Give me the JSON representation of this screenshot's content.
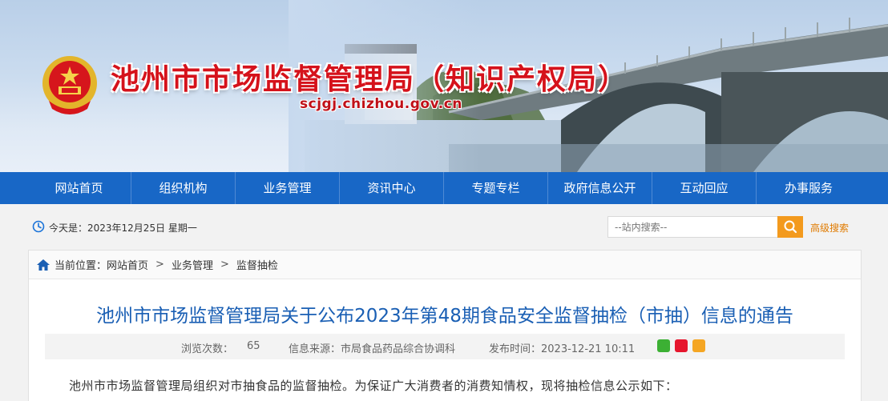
{
  "header": {
    "site_title": "池州市市场监督管理局（知识产权局）",
    "site_domain": "scjgj.chizhou.gov.cn",
    "emblem_icon": "national-emblem-icon"
  },
  "nav": {
    "items": [
      "网站首页",
      "组织机构",
      "业务管理",
      "资讯中心",
      "专题专栏",
      "政府信息公开",
      "互动回应",
      "办事服务"
    ]
  },
  "info_bar": {
    "date_text": "今天是：2023年12月25日 星期一",
    "search_placeholder": "--站内搜索--",
    "advanced_search": "高级搜索"
  },
  "breadcrumb": {
    "label": "当前位置：",
    "items": [
      "网站首页",
      "业务管理",
      "监督抽检"
    ],
    "separator": ">"
  },
  "article": {
    "title": "池州市市场监督管理局关于公布2023年第48期食品安全监督抽检（市抽）信息的通告",
    "views_label": "浏览次数：",
    "views_count": "65",
    "source": "信息来源：市局食品药品综合协调科",
    "publish_time": "发布时间：2023-12-21 10:11",
    "body_first_line": "池州市市场监督管理局组织对市抽食品的监督抽检。为保证广大消费者的消费知情权，现将抽检信息公示如下："
  },
  "colors": {
    "nav_bg": "#1867c6",
    "title_red": "#d5121b",
    "article_title_blue": "#1a5fb4",
    "search_button": "#f39a1e"
  }
}
